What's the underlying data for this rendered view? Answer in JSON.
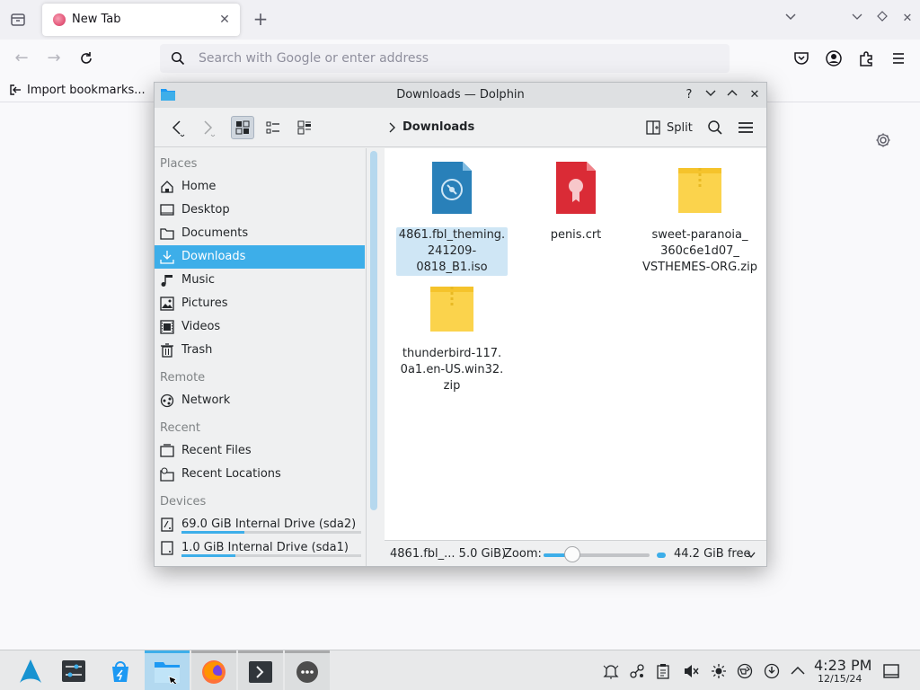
{
  "firefox": {
    "tab_title": "New Tab",
    "url_placeholder": "Search with Google or enter address",
    "bookmark_import": "Import bookmarks..."
  },
  "dolphin": {
    "window_title": "Downloads — Dolphin",
    "breadcrumb": "Downloads",
    "split_label": "Split",
    "sidebar": {
      "places_header": "Places",
      "places": [
        {
          "label": "Home",
          "icon": "home-icon"
        },
        {
          "label": "Desktop",
          "icon": "desktop-icon"
        },
        {
          "label": "Documents",
          "icon": "documents-icon"
        },
        {
          "label": "Downloads",
          "icon": "downloads-icon"
        },
        {
          "label": "Music",
          "icon": "music-icon"
        },
        {
          "label": "Pictures",
          "icon": "pictures-icon"
        },
        {
          "label": "Videos",
          "icon": "videos-icon"
        },
        {
          "label": "Trash",
          "icon": "trash-icon"
        }
      ],
      "remote_header": "Remote",
      "remote": [
        {
          "label": "Network",
          "icon": "network-icon"
        }
      ],
      "recent_header": "Recent",
      "recent": [
        {
          "label": "Recent Files",
          "icon": "recent-files-icon"
        },
        {
          "label": "Recent Locations",
          "icon": "recent-locations-icon"
        }
      ],
      "devices_header": "Devices",
      "devices": [
        {
          "label": "69.0 GiB Internal Drive (sda2)",
          "usage": 0.35
        },
        {
          "label": "1.0 GiB Internal Drive (sda1)",
          "usage": 0.3
        }
      ]
    },
    "files": [
      {
        "name_lines": [
          "4861.fbl_theming.",
          "241209-0818_B1.iso"
        ],
        "type": "iso",
        "selected": true
      },
      {
        "name_lines": [
          "penis.crt"
        ],
        "type": "certificate",
        "selected": false
      },
      {
        "name_lines": [
          "sweet-paranoia_",
          "360c6e1d07_",
          "VSTHEMES-ORG.zip"
        ],
        "type": "zip",
        "selected": false
      },
      {
        "name_lines": [
          "thunderbird-117.",
          "0a1.en-US.win32.",
          "zip"
        ],
        "type": "zip",
        "selected": false
      }
    ],
    "status": {
      "selection": "4861.fbl_... 5.0 GiB)",
      "zoom_label": "Zoom:",
      "zoom_level": 0.3,
      "free_space": "44.2 GiB free"
    }
  },
  "taskbar": {
    "clock_time": "4:23 PM",
    "clock_date": "12/15/24"
  },
  "colors": {
    "accent": "#3daee9",
    "selection_bg": "#cfe6f5"
  }
}
